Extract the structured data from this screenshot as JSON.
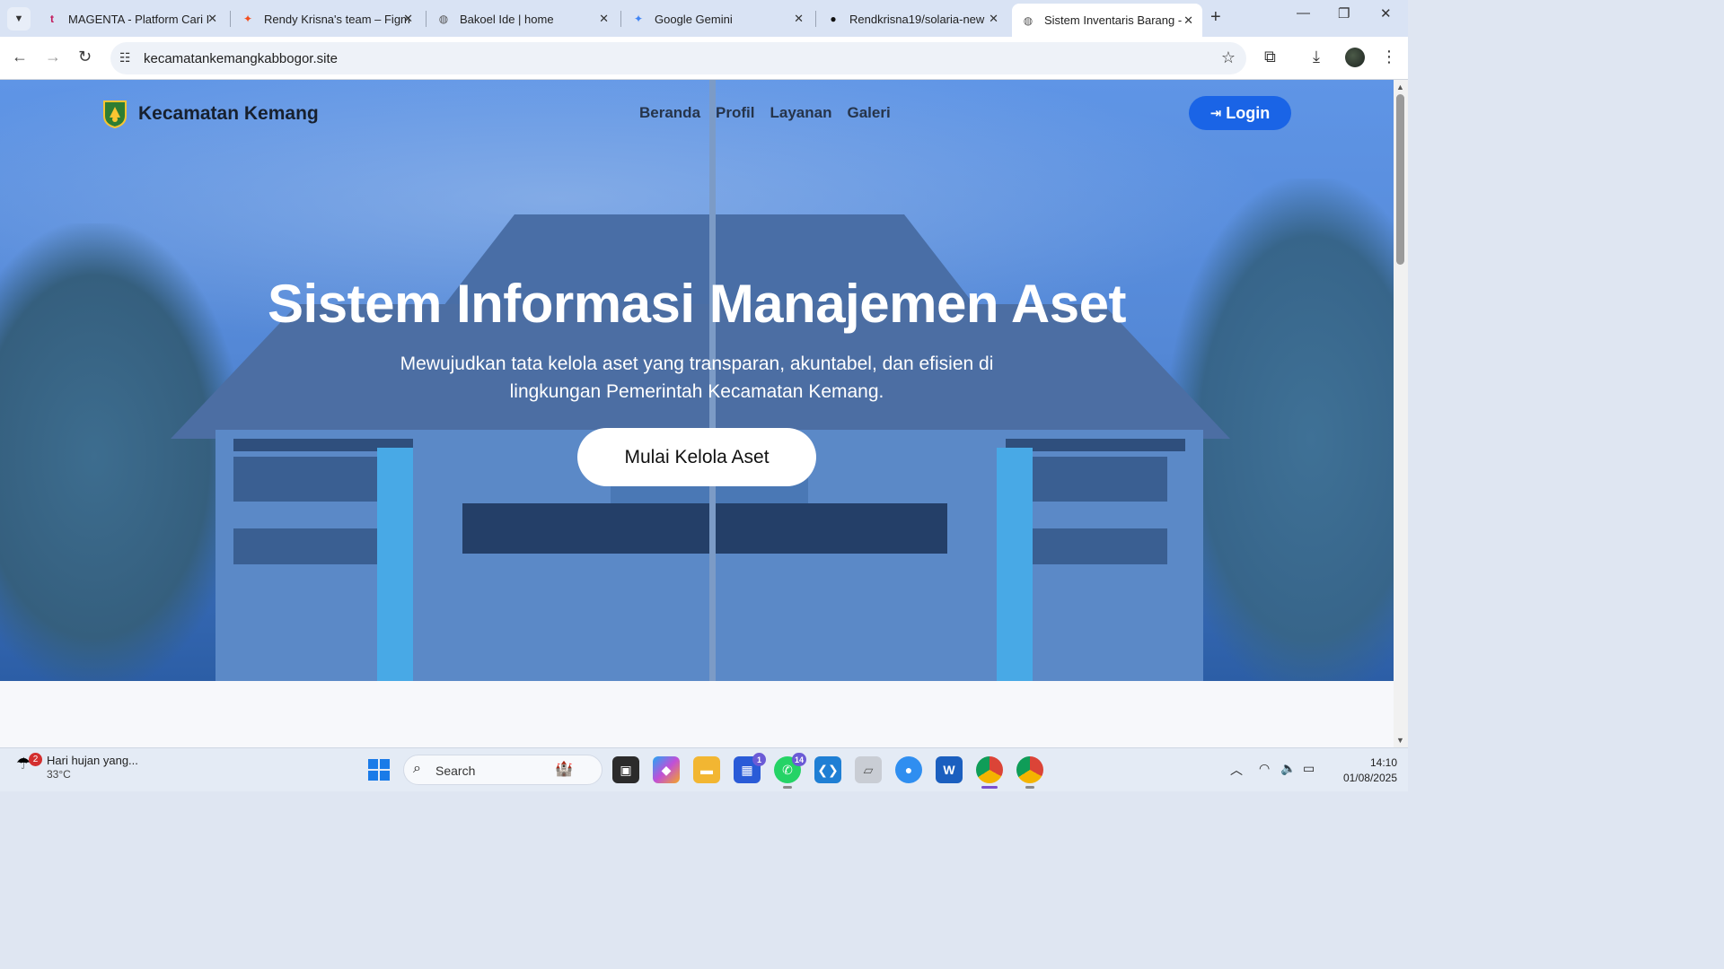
{
  "browser": {
    "tabs": [
      {
        "title": "MAGENTA - Platform Cari I",
        "favicon": "magenta-icon",
        "color": "#c2185b"
      },
      {
        "title": "Rendy Krisna's team – Figm",
        "favicon": "figma-icon",
        "color": "#f24e1e"
      },
      {
        "title": "Bakoel Ide | home",
        "favicon": "globe-icon",
        "color": "#555555"
      },
      {
        "title": "Google Gemini",
        "favicon": "gemini-icon",
        "color": "#4285f4"
      },
      {
        "title": "Rendkrisna19/solaria-new",
        "favicon": "github-icon",
        "color": "#111111"
      },
      {
        "title": "Sistem Inventaris Barang -",
        "favicon": "globe-icon",
        "color": "#555555",
        "active": true
      }
    ],
    "url": "kecamatankemangkabbogor.site"
  },
  "site": {
    "brand": "Kecamatan Kemang",
    "nav": [
      "Beranda",
      "Profil",
      "Layanan",
      "Galeri"
    ],
    "login_label": "Login",
    "hero_title": "Sistem Informasi Manajemen Aset",
    "hero_subtitle": "Mewujudkan tata kelola aset yang transparan, akuntabel, dan efisien di lingkungan Pemerintah Kecamatan Kemang.",
    "cta_label": "Mulai Kelola Aset",
    "primary_color": "#1a64e6"
  },
  "taskbar": {
    "weather_text": "Hari hujan yang...",
    "weather_temp": "33°C",
    "weather_badge": "2",
    "search_placeholder": "Search",
    "apps": [
      {
        "name": "task-view-icon"
      },
      {
        "name": "copilot-icon"
      },
      {
        "name": "file-explorer-icon"
      },
      {
        "name": "microsoft-store-icon",
        "badge": "1"
      },
      {
        "name": "whatsapp-icon",
        "badge": "14"
      },
      {
        "name": "vscode-icon"
      },
      {
        "name": "app-icon"
      },
      {
        "name": "app-icon-blue"
      },
      {
        "name": "word-icon"
      },
      {
        "name": "chrome-icon"
      },
      {
        "name": "chrome-profile-icon"
      }
    ],
    "time": "14:10",
    "date": "01/08/2025"
  }
}
